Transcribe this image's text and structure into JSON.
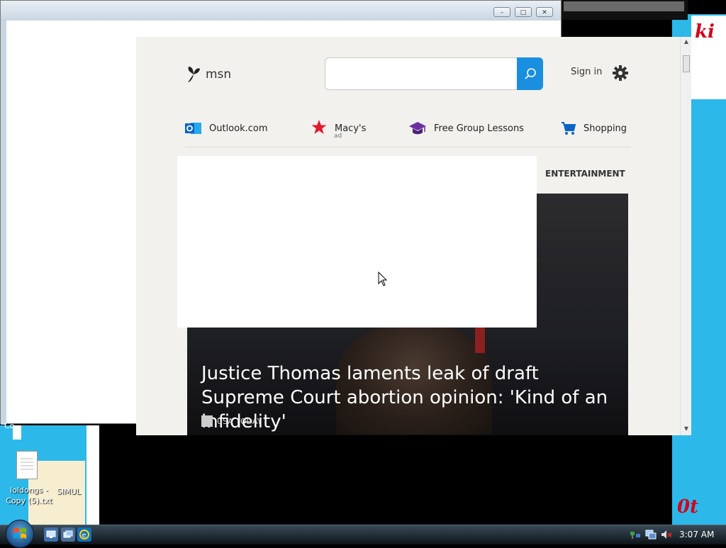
{
  "desktop": {
    "background_text_right": "ki",
    "background_text_bottom": "0t",
    "partial_label": "Co",
    "icons": [
      {
        "name": "loldongs - Copy (5).txt"
      },
      {
        "name": "SIMUL"
      }
    ]
  },
  "back_window": {
    "controls": {
      "minimize": "–",
      "maximize": "□",
      "close": "✕"
    }
  },
  "msn": {
    "logo": "msn",
    "search": {
      "placeholder": ""
    },
    "sign_in": "Sign in",
    "quick_links": [
      {
        "label": "Outlook.com",
        "icon": "outlook-icon"
      },
      {
        "label": "Macy's",
        "sublabel": "ad",
        "icon": "macys-star-icon"
      },
      {
        "label": "Free Group Lessons",
        "icon": "graduation-cap-icon"
      },
      {
        "label": "Shopping",
        "icon": "shopping-cart-icon"
      }
    ],
    "section_label": "ENTERTAINMENT",
    "hero": {
      "headline": "Justice Thomas laments leak of draft Supreme Court abortion opinion: 'Kind of an infidelity'",
      "source": "USA TODAY"
    },
    "colors": {
      "search_button": "#1a8fe0",
      "macys_red": "#e21a2c",
      "lessons_purple": "#6b2fa0"
    }
  },
  "taskbar": {
    "clock": "3:07 AM",
    "quick_launch": [
      "show-desktop-icon",
      "switch-windows-icon",
      "internet-explorer-icon"
    ],
    "tray": [
      "network-icon",
      "monitor-icon",
      "volume-muted-icon"
    ]
  }
}
